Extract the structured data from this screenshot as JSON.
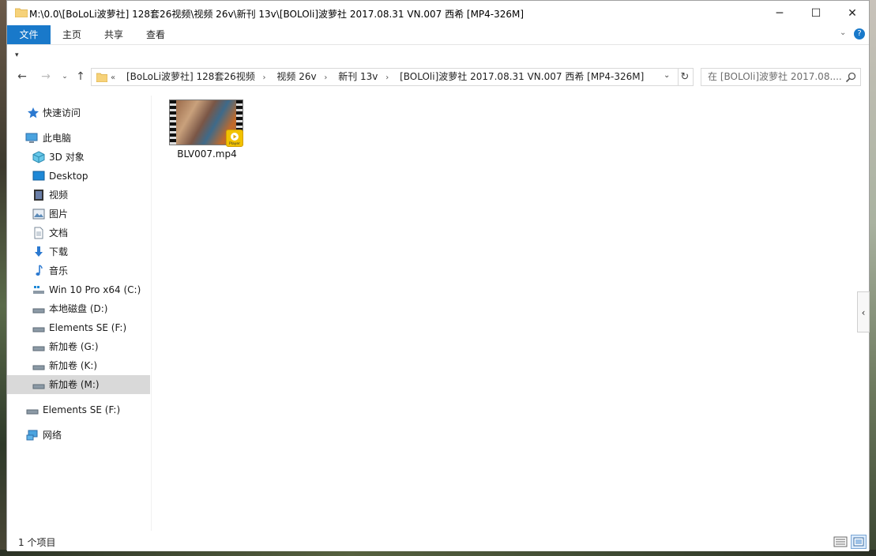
{
  "window": {
    "title": "M:\\0.0\\[BoLoLi波萝社] 128套26视频\\视频 26v\\新刊 13v\\[BOLOli]波萝社 2017.08.31 VN.007 西希 [MP4-326M]",
    "minimize_glyph": "─",
    "maximize_glyph": "☐",
    "close_glyph": "✕"
  },
  "ribbon": {
    "file_label": "文件",
    "tabs": [
      {
        "label": "主页"
      },
      {
        "label": "共享"
      },
      {
        "label": "查看"
      }
    ],
    "expand_glyph": "⌄",
    "help_glyph": "?"
  },
  "quick_access_toolbar": {
    "customize_glyph": "▾"
  },
  "navigation": {
    "back_glyph": "←",
    "forward_glyph": "→",
    "recent_glyph": "⌄",
    "up_glyph": "↑",
    "refresh_glyph": "↻",
    "overflow_glyph": "«",
    "dropdown_glyph": "⌄",
    "breadcrumb": [
      "[BoLoLi波萝社] 128套26视频",
      "视频 26v",
      "新刊 13v",
      "[BOLOli]波萝社 2017.08.31 VN.007 西希 [MP4-326M]"
    ],
    "breadcrumb_sep": "›",
    "search_placeholder": "在 [BOLOli]波萝社 2017.08...."
  },
  "sidebar": {
    "items": [
      {
        "label": "快速访问",
        "icon": "star-icon"
      },
      {
        "label": "此电脑",
        "icon": "computer-icon"
      },
      {
        "label": "3D 对象",
        "icon": "cube-icon"
      },
      {
        "label": "Desktop",
        "icon": "desktop-icon"
      },
      {
        "label": "视频",
        "icon": "video-icon"
      },
      {
        "label": "图片",
        "icon": "picture-icon"
      },
      {
        "label": "文档",
        "icon": "document-icon"
      },
      {
        "label": "下载",
        "icon": "download-icon"
      },
      {
        "label": "音乐",
        "icon": "music-icon"
      },
      {
        "label": "Win 10 Pro x64 (C:)",
        "icon": "system-drive-icon"
      },
      {
        "label": "本地磁盘 (D:)",
        "icon": "drive-icon"
      },
      {
        "label": "Elements SE (F:)",
        "icon": "drive-icon"
      },
      {
        "label": "新加卷 (G:)",
        "icon": "drive-icon"
      },
      {
        "label": "新加卷 (K:)",
        "icon": "drive-icon"
      },
      {
        "label": "新加卷 (M:)",
        "icon": "drive-icon",
        "selected": true
      },
      {
        "label": "Elements SE (F:)",
        "icon": "drive-icon"
      },
      {
        "label": "网络",
        "icon": "network-icon"
      }
    ]
  },
  "files": [
    {
      "name": "BLV007.mp4",
      "badge": "Player"
    }
  ],
  "pane_toggle_glyph": "‹",
  "status": {
    "count_text": "1 个项目"
  },
  "colors": {
    "accent": "#1979ca",
    "selected_bg": "#d9d9d9"
  }
}
